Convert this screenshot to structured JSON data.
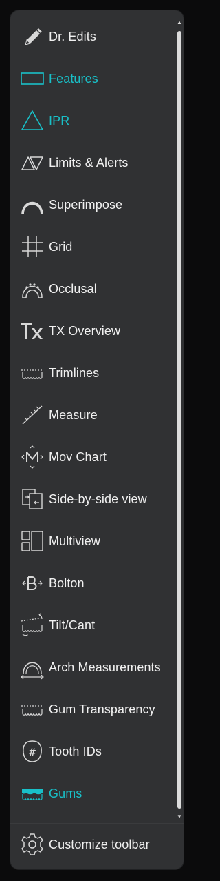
{
  "menu": {
    "items": [
      {
        "label": "Dr. Edits",
        "icon": "pencil-icon"
      },
      {
        "label": "Features",
        "icon": "rectangle-icon"
      },
      {
        "label": "IPR",
        "icon": "triangle-icon"
      },
      {
        "label": "Limits & Alerts",
        "icon": "limits-alerts-icon"
      },
      {
        "label": "Superimpose",
        "icon": "superimpose-icon"
      },
      {
        "label": "Grid",
        "icon": "grid-icon"
      },
      {
        "label": "Occlusal",
        "icon": "occlusal-icon"
      },
      {
        "label": "TX Overview",
        "icon": "tx-overview-icon"
      },
      {
        "label": "Trimlines",
        "icon": "trimlines-icon"
      },
      {
        "label": "Measure",
        "icon": "ruler-icon"
      },
      {
        "label": "Mov Chart",
        "icon": "mov-chart-icon"
      },
      {
        "label": "Side-by-side view",
        "icon": "side-by-side-icon"
      },
      {
        "label": "Multiview",
        "icon": "multiview-icon"
      },
      {
        "label": "Bolton",
        "icon": "bolton-icon"
      },
      {
        "label": "Tilt/Cant",
        "icon": "tilt-cant-icon"
      },
      {
        "label": "Arch Measurements",
        "icon": "arch-measurements-icon"
      },
      {
        "label": "Gum Transparency",
        "icon": "gum-transparency-icon"
      },
      {
        "label": "Tooth IDs",
        "icon": "tooth-id-icon"
      },
      {
        "label": "Gums",
        "icon": "gums-icon"
      }
    ],
    "active_items": [
      "Features",
      "IPR",
      "Gums"
    ]
  },
  "footer": {
    "customize_label": "Customize toolbar",
    "customize_icon": "gear-icon"
  },
  "colors": {
    "background": "#0b0b0c",
    "panel": "#303133",
    "text": "#f0f0f0",
    "accent": "#19c0c8",
    "icon": "#d8d8d8",
    "scrollbar": "#dcdcdc"
  }
}
